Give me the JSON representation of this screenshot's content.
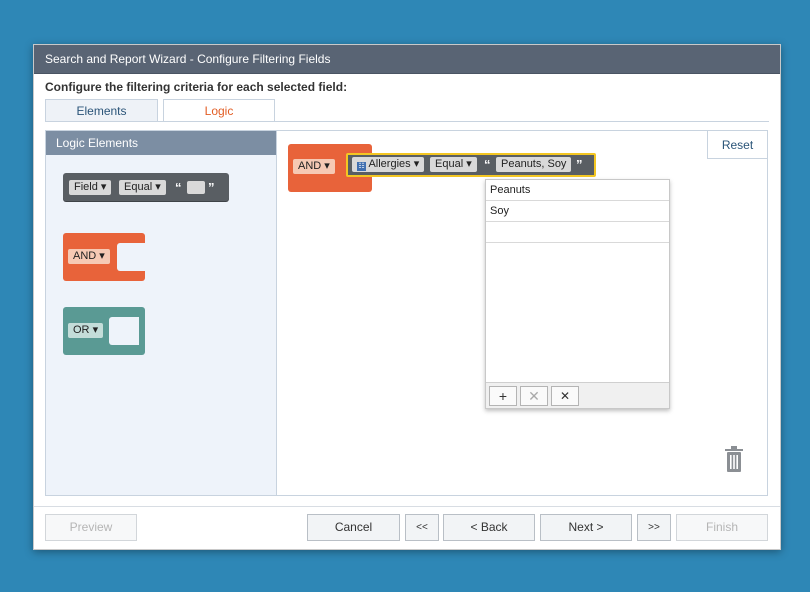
{
  "window": {
    "title": "Search and Report Wizard - Configure Filtering Fields"
  },
  "subtitle": "Configure the filtering criteria for each selected field:",
  "tabs": [
    {
      "label": "Elements",
      "active": false
    },
    {
      "label": "Logic",
      "active": true
    }
  ],
  "logic_panel": {
    "header": "Logic Elements",
    "field_block": {
      "field_label": "Field",
      "operator_label": "Equal",
      "open_quote": "“",
      "close_quote": "”"
    },
    "and_block": {
      "label": "AND"
    },
    "or_block": {
      "label": "OR"
    }
  },
  "canvas": {
    "reset_label": "Reset",
    "and_label": "AND",
    "condition": {
      "field": "Allergies",
      "operator": "Equal",
      "open_quote": "“",
      "value": "Peanuts, Soy",
      "close_quote": "”"
    },
    "dropdown": {
      "items": [
        "Peanuts",
        "Soy",
        ""
      ],
      "add_label": "+",
      "delete_label": "✕",
      "clear_label": "✕"
    }
  },
  "footer": {
    "preview": "Preview",
    "cancel": "Cancel",
    "first": "<<",
    "back": "< Back",
    "next": "Next >",
    "last": ">>",
    "finish": "Finish"
  },
  "colors": {
    "background": "#2e87b6",
    "titlebar": "#596474",
    "accent": "#e25d24",
    "and_block": "#e8633a",
    "or_block": "#5a9a94",
    "field_block": "#595e63",
    "selected_outline": "#f3c622"
  }
}
